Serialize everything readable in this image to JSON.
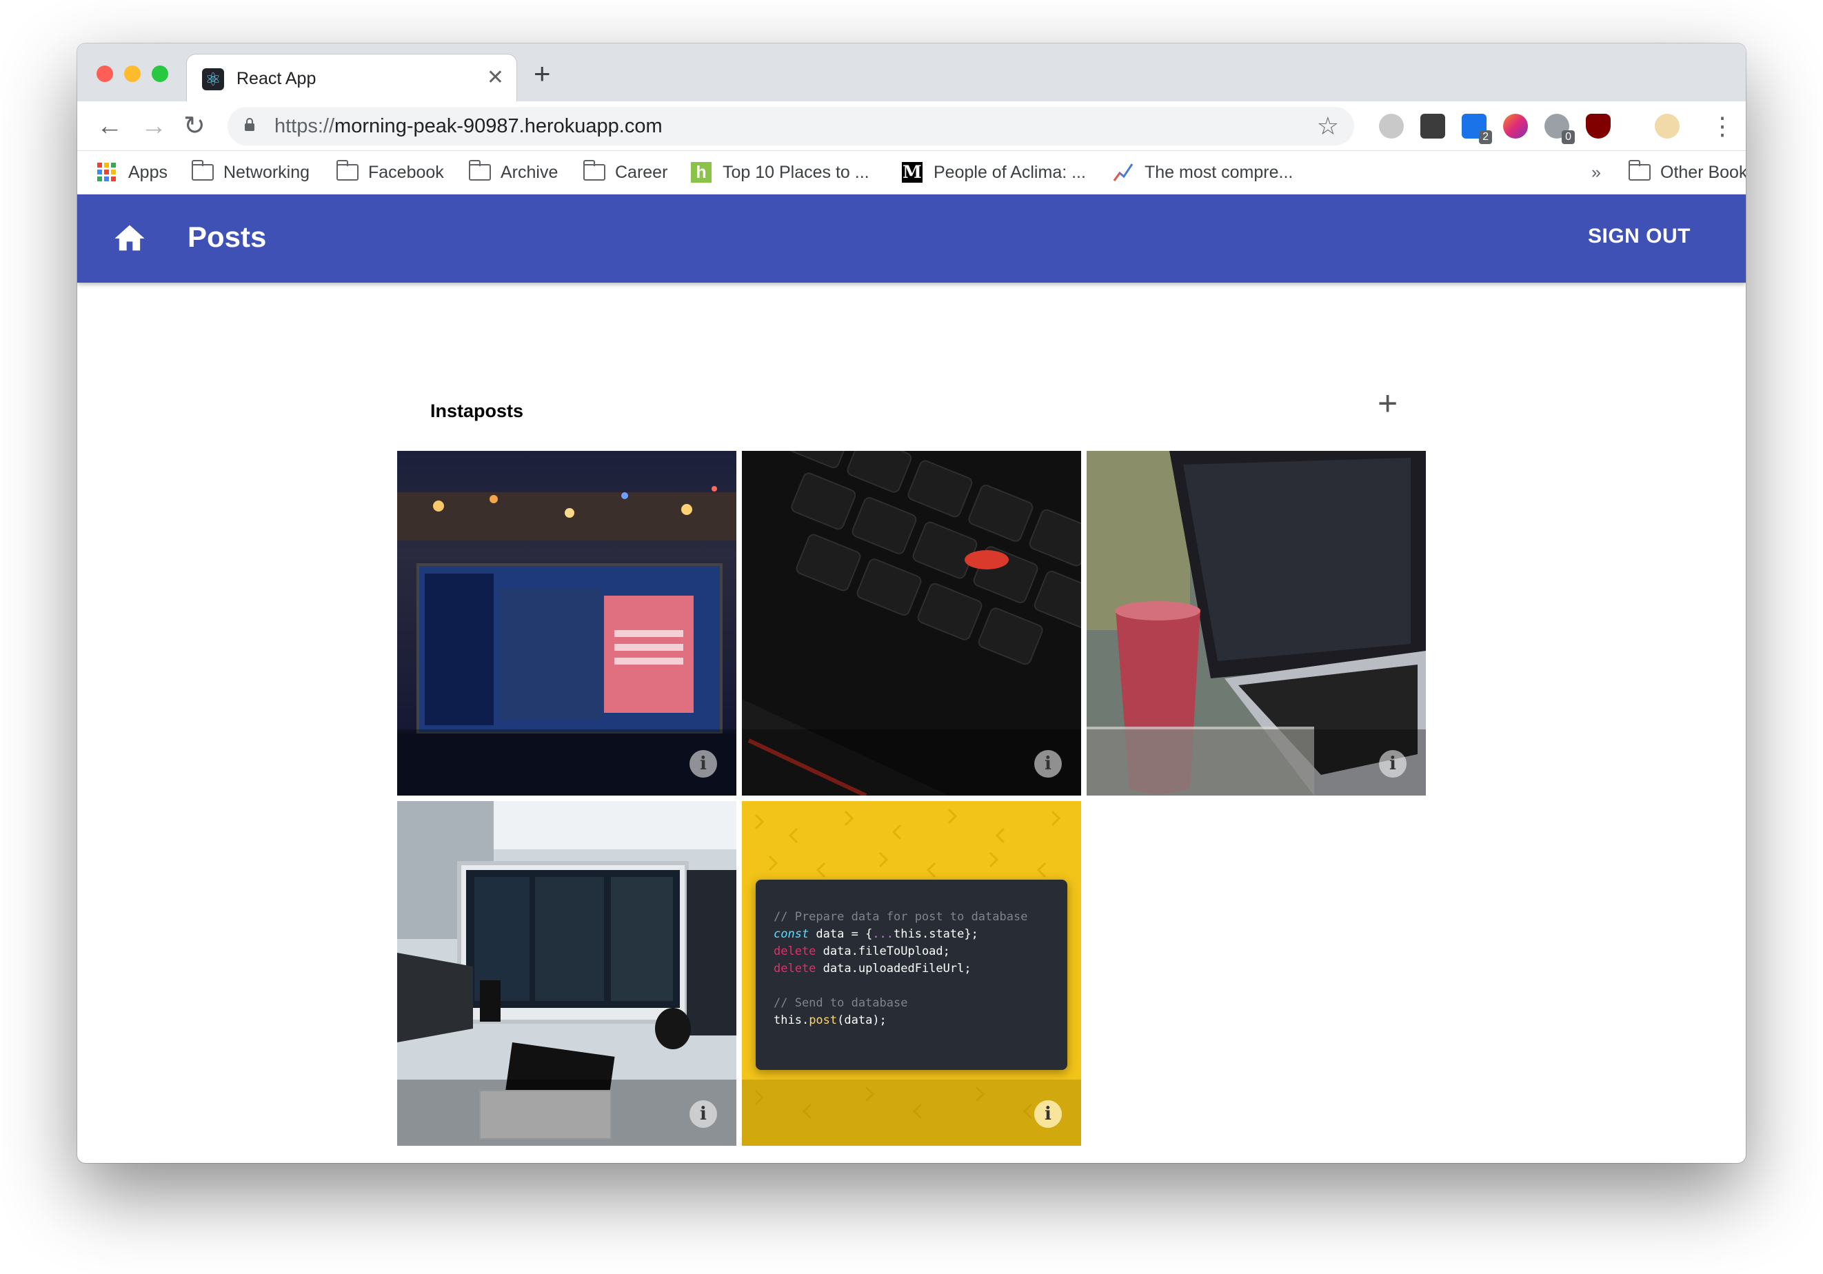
{
  "browser": {
    "tab_title": "React App",
    "url_scheme": "https://",
    "url_host": "morning-peak-90987.herokuapp.com",
    "extension_badges": [
      "2",
      "0"
    ],
    "bookmarks": [
      {
        "label": "Apps",
        "icon": "apps-grid-icon"
      },
      {
        "label": "Networking",
        "icon": "folder-icon"
      },
      {
        "label": "Facebook",
        "icon": "folder-icon"
      },
      {
        "label": "Archive",
        "icon": "folder-icon"
      },
      {
        "label": "Career",
        "icon": "folder-icon"
      },
      {
        "label": "Top 10 Places to ...",
        "icon": "site-favicon"
      },
      {
        "label": "People of Aclima: ...",
        "icon": "medium-icon"
      },
      {
        "label": "The most compre...",
        "icon": "chart-favicon"
      },
      {
        "label": "Other Bookmarks",
        "icon": "folder-icon"
      }
    ],
    "overflow": "»"
  },
  "app": {
    "title": "Posts",
    "sign_out": "SIGN OUT",
    "accent_color": "#3f51b5",
    "section_title": "Instaposts",
    "add_icon": "+",
    "info_icon": "i",
    "tiles": [
      {
        "subject": "laptop on city night street"
      },
      {
        "subject": "keyboard trackpoint"
      },
      {
        "subject": "laptop with smoothie"
      },
      {
        "subject": "desk with monitors"
      },
      {
        "subject": "code snippet on yellow"
      }
    ],
    "code_snippet": {
      "line1": "// Prepare data for post to database",
      "line2a": "const",
      "line2b": " data = {",
      "line2c": "...",
      "line2d": "this.state};",
      "line3a": "delete",
      "line3b": " data.fileToUpload;",
      "line4a": "delete",
      "line4b": " data.uploadedFileUrl;",
      "line5": "// Send to database",
      "line6a": "this.",
      "line6b": "post",
      "line6c": "(data);"
    }
  }
}
